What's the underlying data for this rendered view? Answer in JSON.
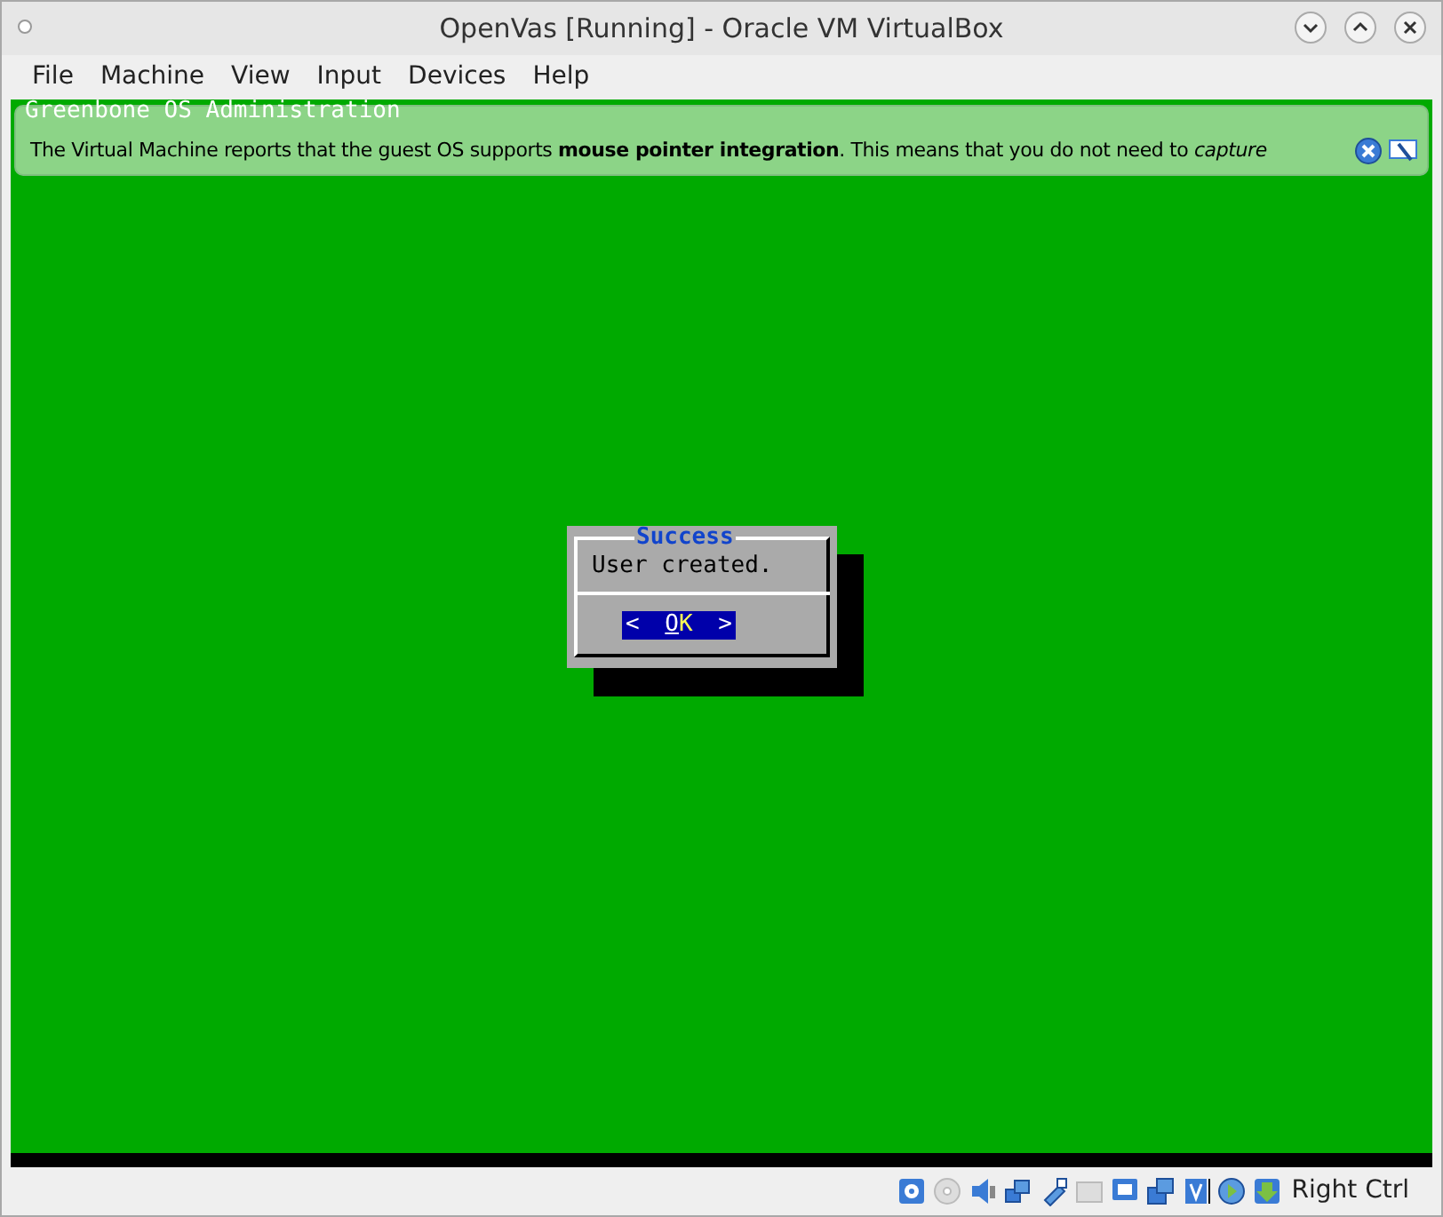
{
  "window": {
    "title": "OpenVas [Running] - Oracle VM VirtualBox"
  },
  "menu": [
    "File",
    "Machine",
    "View",
    "Input",
    "Devices",
    "Help"
  ],
  "console": {
    "header": "Greenbone OS Administration"
  },
  "notification": {
    "text": "The Virtual Machine reports that the guest OS supports **mouse pointer integration**. This means that you do not need to *capture*"
  },
  "dialog": {
    "title": "Success",
    "message": "User created.",
    "button": {
      "left": "<",
      "label": "OK",
      "right": ">"
    }
  },
  "status_bar": {
    "host_key": "Right Ctrl"
  }
}
